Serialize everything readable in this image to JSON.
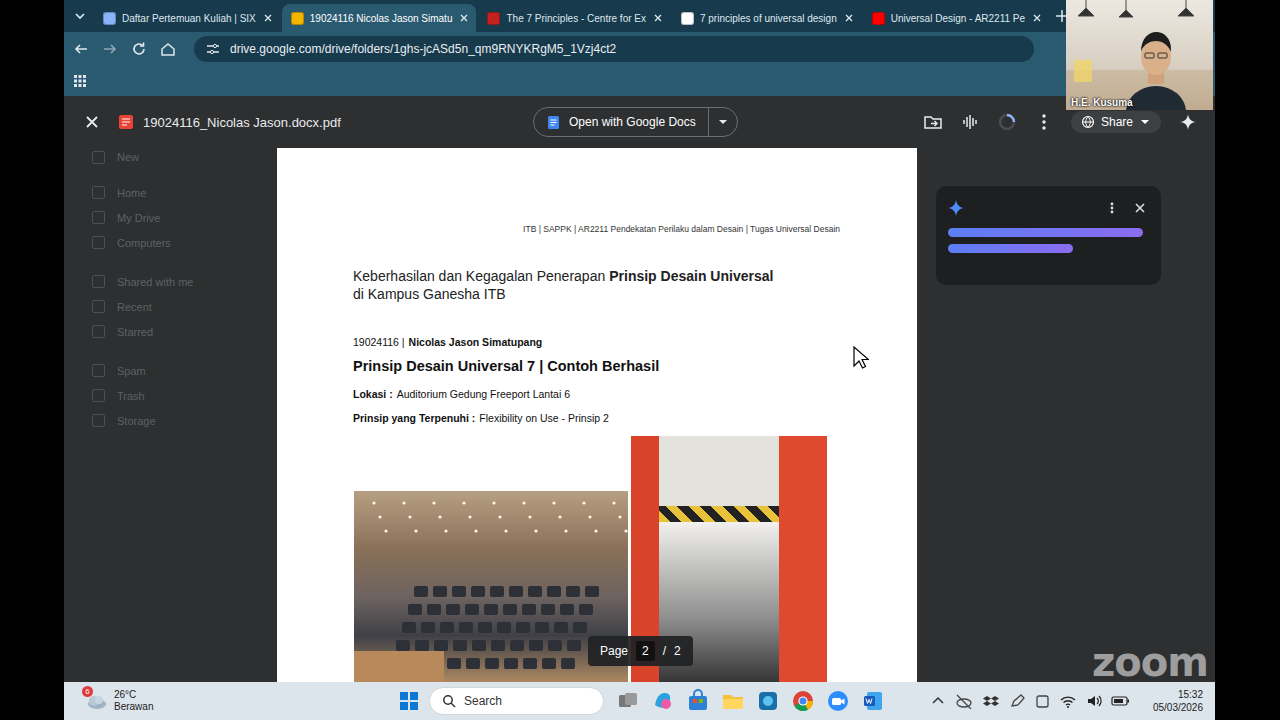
{
  "browser": {
    "tabs": [
      {
        "label": "Daftar Pertemuan Kuliah | SIX",
        "selected": false,
        "color": "#8ab4f8"
      },
      {
        "label": "19024116 Nicolas Jason Simatu",
        "selected": true,
        "color": "#f4b400"
      },
      {
        "label": "The 7 Principles - Centre for Ex",
        "selected": false,
        "color": "#c5221f"
      },
      {
        "label": "7 principles of universal design",
        "selected": false,
        "color": "#ffffff"
      },
      {
        "label": "Universal Design - AR2211 Pe",
        "selected": false,
        "color": "#ff0000"
      }
    ],
    "address": "drive.google.com/drive/folders/1ghs-jcASd5n_qm9RNYKRgM5_1Vzj4ct2"
  },
  "viewer": {
    "file_name": "19024116_Nicolas Jason.docx.pdf",
    "open_button": "Open with Google Docs",
    "share": "Share"
  },
  "sidebar": {
    "groups": [
      [
        "New"
      ],
      [
        "Home",
        "My Drive",
        "Computers"
      ],
      [
        "Shared with me",
        "Recent",
        "Starred"
      ],
      [
        "Spam",
        "Trash",
        "Storage"
      ]
    ]
  },
  "document": {
    "header": "ITB | SAPPK | AR2211 Pendekatan Perilaku dalam Desain | Tugas Universal Desain",
    "title_regular": "Keberhasilan dan Kegagalan Penerapan",
    "title_bold": "Prinsip Desain Universal",
    "title_line2": "di Kampus Ganesha ITB",
    "student_id": "19024116 |",
    "student_name": "Nicolas Jason Simatupang",
    "heading": "Prinsip Desain Universal 7 | Contoh Berhasil",
    "fields": [
      {
        "label": "Lokasi :",
        "value": "Auditorium Gedung Freeport Lantai 6"
      },
      {
        "label": "Prinsip yang Terpenuhi :",
        "value": "Flexibility on Use - Prinsip 2"
      }
    ]
  },
  "page_indicator": {
    "label": "Page",
    "current": "2",
    "separator": "/",
    "total": "2"
  },
  "video": {
    "name": "H.E. Kusuma"
  },
  "watermark": "zoom",
  "taskbar": {
    "weather": {
      "badge": "6",
      "temp": "26°C",
      "desc": "Berawan"
    },
    "search": "Search",
    "time": "15:32",
    "date": "05/03/2026"
  }
}
